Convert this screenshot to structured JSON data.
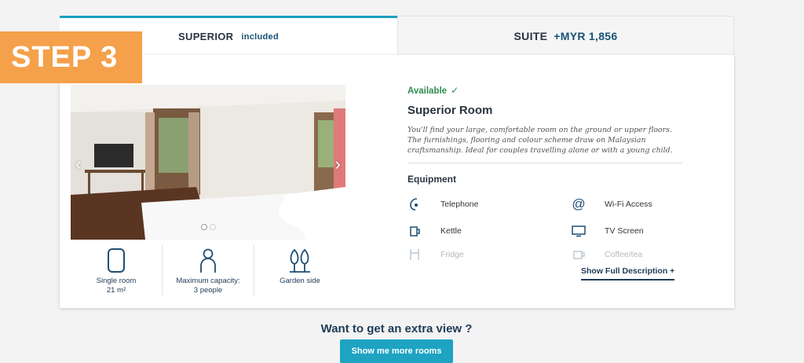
{
  "step_badge": "STEP 3",
  "tabs": [
    {
      "name": "SUPERIOR",
      "tag": "included"
    },
    {
      "name": "SUITE",
      "price": "+MYR 1,856"
    }
  ],
  "photo": {
    "prev": "‹",
    "next": "›",
    "slides": 2,
    "active_slide": 1
  },
  "features": [
    {
      "icon": "room-size-icon",
      "label_line1": "Single room",
      "label_line2": "21 m²"
    },
    {
      "icon": "person-icon",
      "label_line1": "Maximum capacity:",
      "label_line2": "3 people"
    },
    {
      "icon": "trees-icon",
      "label_line1": "Garden side",
      "label_line2": ""
    }
  ],
  "room": {
    "availability": "Available",
    "availability_check": "✓",
    "title": "Superior Room",
    "description": "You'll find your large, comfortable room on the ground or upper floors. The furnishings, flooring and colour scheme draw on Malaysian craftsmanship. Ideal for couples travelling alone or with a young child."
  },
  "equipment": {
    "title": "Equipment",
    "items": [
      {
        "label": "Telephone",
        "icon": "telephone-icon"
      },
      {
        "label": "Wi-Fi Access",
        "icon": "wifi-icon"
      },
      {
        "label": "Kettle",
        "icon": "kettle-icon"
      },
      {
        "label": "TV Screen",
        "icon": "tv-icon"
      },
      {
        "label": "Fridge",
        "icon": "fridge-icon"
      },
      {
        "label": "Coffee/tea",
        "icon": "coffee-icon"
      }
    ]
  },
  "show_full_description": "Show Full Description +",
  "extra_view": {
    "title": "Want to get an extra view ?",
    "button": "Show me more rooms"
  },
  "colors": {
    "accent": "#1ea3c2",
    "badge": "#f5a04a",
    "available": "#2e8b4e",
    "navy": "#1f3b57"
  }
}
